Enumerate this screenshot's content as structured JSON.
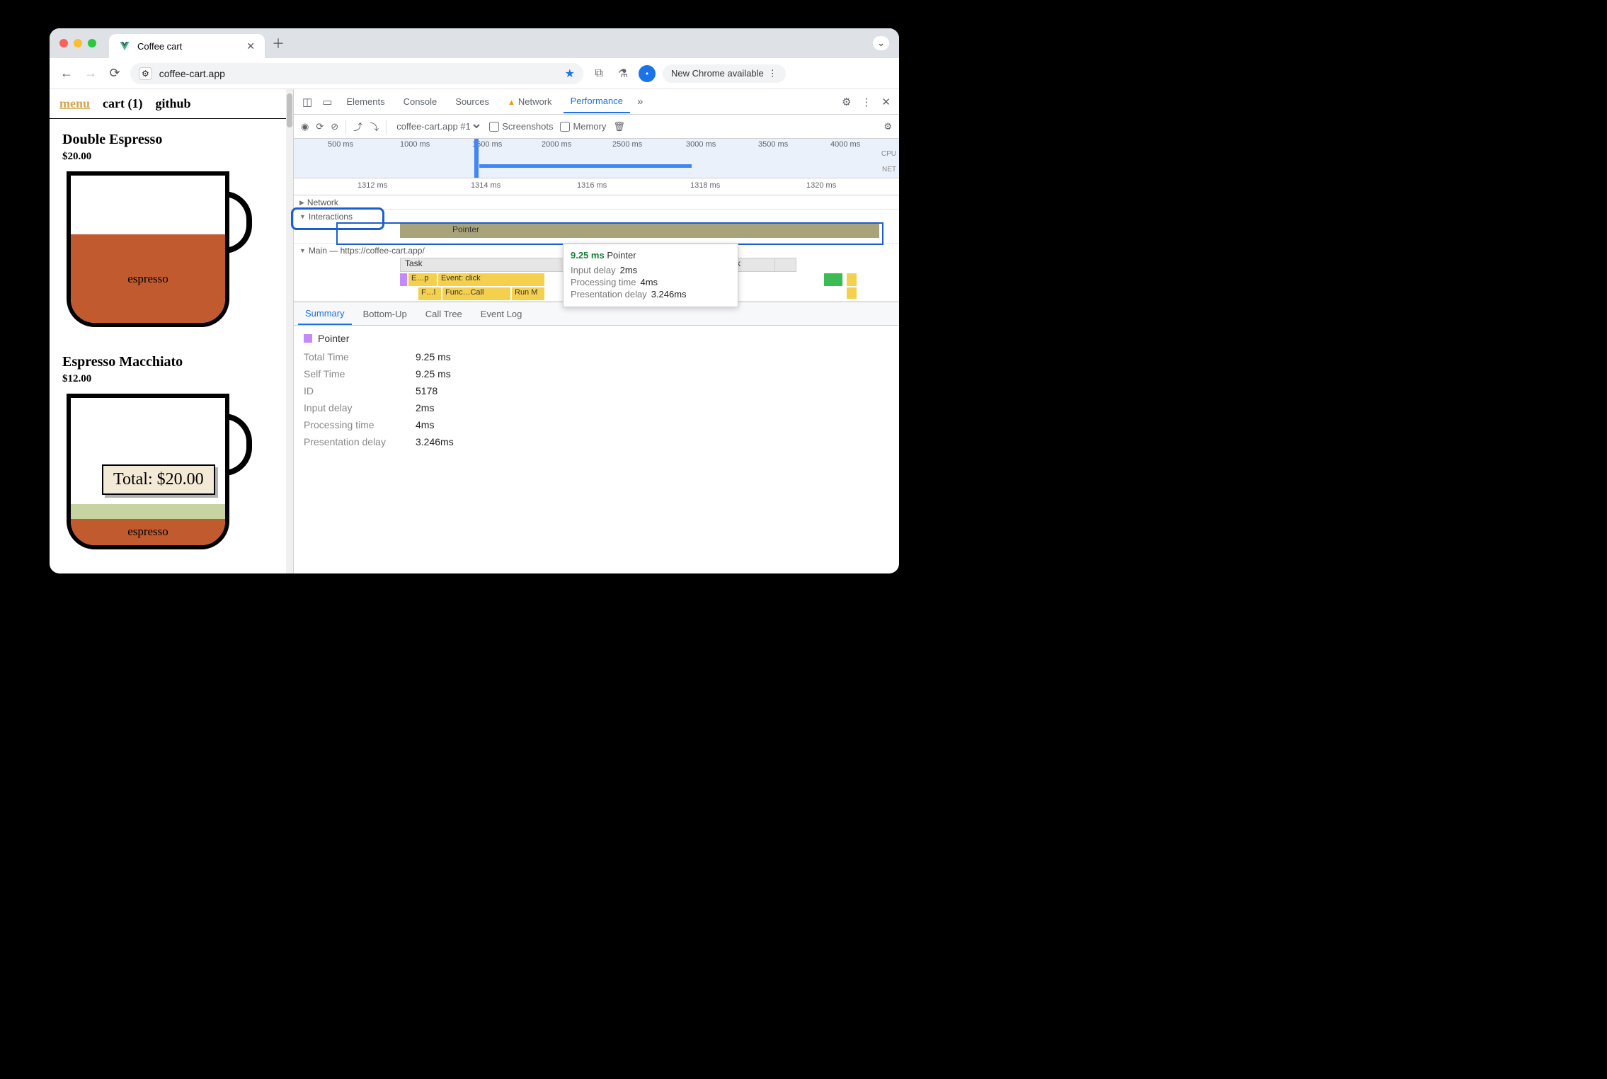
{
  "browser": {
    "tab_title": "Coffee cart",
    "url": "coffee-cart.app",
    "update_chip": "New Chrome available"
  },
  "page": {
    "nav": {
      "menu": "menu",
      "cart": "cart (1)",
      "github": "github"
    },
    "products": [
      {
        "name": "Double Espresso",
        "price": "$20.00",
        "fill_label": "espresso",
        "fill_pct": 60
      },
      {
        "name": "Espresso Macchiato",
        "price": "$12.00",
        "fill_label": "espresso",
        "fill_pct": 18
      }
    ],
    "total_label": "Total: $20.00"
  },
  "devtools": {
    "tabs": [
      "Elements",
      "Console",
      "Sources",
      "Network",
      "Performance"
    ],
    "active_tab": "Performance",
    "recording_select": "coffee-cart.app #1",
    "checkboxes": {
      "screenshots": "Screenshots",
      "memory": "Memory"
    },
    "overview_ticks": [
      "500 ms",
      "1000 ms",
      "1500 ms",
      "2000 ms",
      "2500 ms",
      "3000 ms",
      "3500 ms",
      "4000 ms"
    ],
    "overview_labels": [
      "CPU",
      "NET"
    ],
    "ruler_ticks": [
      "1312 ms",
      "1314 ms",
      "1316 ms",
      "1318 ms",
      "1320 ms"
    ],
    "tracks": {
      "network": "Network",
      "interactions": "Interactions",
      "main": "Main — https://coffee-cart.app/",
      "pointer": "Pointer",
      "task": "Task",
      "segments": [
        "E…p",
        "Event: click"
      ],
      "fn_segments": [
        "F…l",
        "Func…Call",
        "Run M"
      ]
    },
    "tooltip": {
      "duration": "9.25 ms",
      "name": "Pointer",
      "rows": [
        {
          "k": "Input delay",
          "v": "2ms"
        },
        {
          "k": "Processing time",
          "v": "4ms"
        },
        {
          "k": "Presentation delay",
          "v": "3.246ms"
        }
      ]
    },
    "summary_tabs": [
      "Summary",
      "Bottom-Up",
      "Call Tree",
      "Event Log"
    ],
    "summary": {
      "title": "Pointer",
      "rows": [
        {
          "k": "Total Time",
          "v": "9.25 ms"
        },
        {
          "k": "Self Time",
          "v": "9.25 ms"
        },
        {
          "k": "ID",
          "v": "5178"
        },
        {
          "k": "Input delay",
          "v": "2ms"
        },
        {
          "k": "Processing time",
          "v": "4ms"
        },
        {
          "k": "Presentation delay",
          "v": "3.246ms"
        }
      ]
    }
  }
}
